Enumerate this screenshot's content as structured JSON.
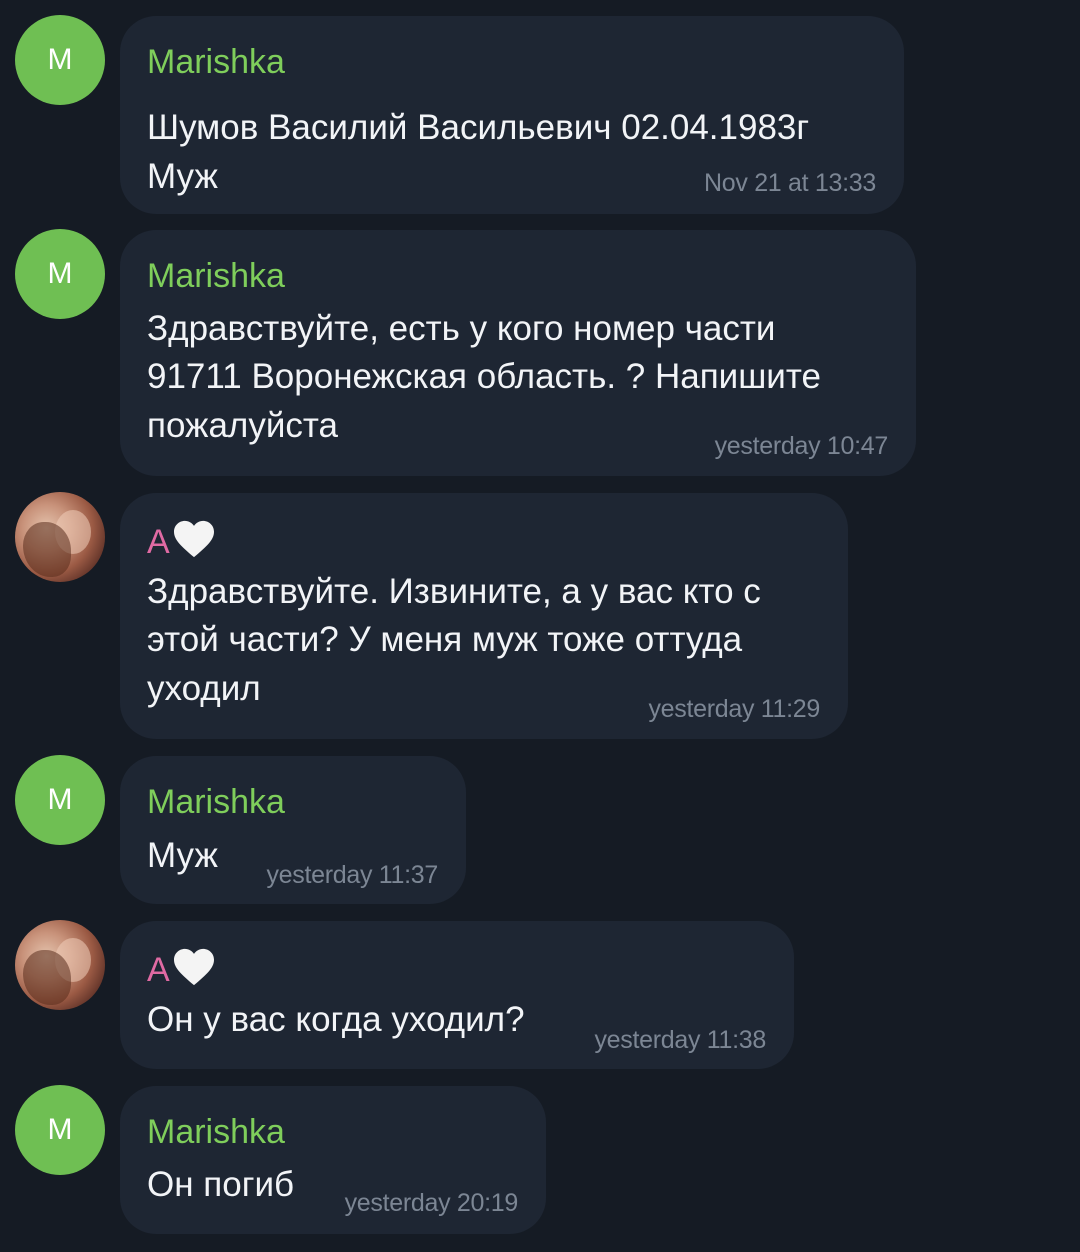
{
  "messages": [
    {
      "avatar_letter": "M",
      "sender": "Marishka",
      "lines": [
        "Шумов Василий Васильевич 02.04.1983г",
        "Муж"
      ],
      "time": "Nov 21 at 13:33"
    },
    {
      "avatar_letter": "M",
      "sender": "Marishka",
      "lines": [
        "Здравствуйте, есть у кого номер части",
        "91711 Воронежская область. ? Напишите",
        "пожалуйста"
      ],
      "time": "yesterday 10:47"
    },
    {
      "avatar_letter": "",
      "sender": "A",
      "lines": [
        "Здравствуйте. Извините, а у вас кто с",
        "этой части? У меня муж тоже оттуда",
        "уходил"
      ],
      "time": "yesterday 11:29"
    },
    {
      "avatar_letter": "M",
      "sender": "Marishka",
      "lines": [
        "Муж"
      ],
      "time": "yesterday 11:37"
    },
    {
      "avatar_letter": "",
      "sender": "A",
      "lines": [
        "Он у вас когда уходил?"
      ],
      "time": "yesterday 11:38"
    },
    {
      "avatar_letter": "M",
      "sender": "Marishka",
      "lines": [
        "Он погиб"
      ],
      "time": "yesterday 20:19"
    }
  ],
  "colors": {
    "background": "#151b24",
    "bubble": "#1e2633",
    "sender_marishka": "#7fce5b",
    "sender_a": "#e06aa3",
    "avatar_m": "#6fbf53",
    "time": "#7c8694"
  },
  "icons": {
    "sender_a_suffix": "white-heart-icon"
  }
}
